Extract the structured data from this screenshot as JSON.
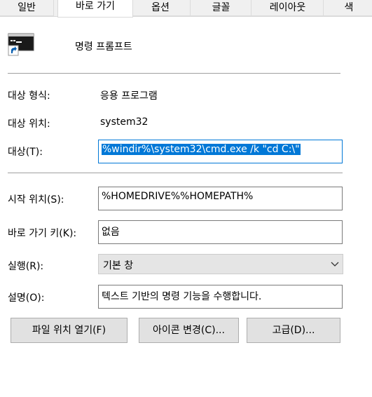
{
  "tabs": [
    "일반",
    "바로 가기",
    "옵션",
    "글꼴",
    "레이아웃",
    "색"
  ],
  "header": {
    "app_name": "명령 프롬프트",
    "icon": "cmd-prompt-icon"
  },
  "properties": {
    "target_type_label": "대상 형식:",
    "target_type_value": "응용 프로그램",
    "target_location_label": "대상 위치:",
    "target_location_value": "system32",
    "target_label": "대상(T):",
    "target_value": "%windir%\\system32\\cmd.exe /k \"cd C:\\\""
  },
  "fields": {
    "start_in_label": "시작 위치(S):",
    "start_in_value": "%HOMEDRIVE%%HOMEPATH%",
    "shortcut_key_label": "바로 가기 키(K):",
    "shortcut_key_value": "없음",
    "run_label": "실행(R):",
    "run_value": "기본 창",
    "comment_label": "설명(O):",
    "comment_value": "텍스트 기반의 명령 기능을 수행합니다."
  },
  "buttons": {
    "open_location": "파일 위치 열기(F)",
    "change_icon": "아이콘 변경(C)...",
    "advanced": "고급(D)..."
  },
  "colors": {
    "accent": "#0078d7",
    "field_border": "#7a7a7a",
    "button_bg": "#e1e1e1"
  }
}
